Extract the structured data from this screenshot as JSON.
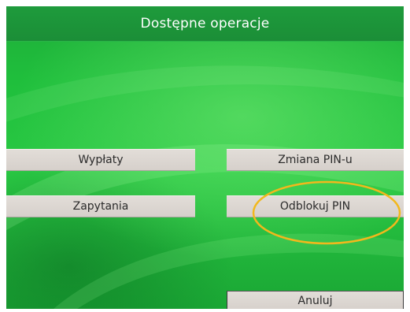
{
  "header": {
    "title": "Dostępne operacje"
  },
  "operations": {
    "withdraw_label": "Wypłaty",
    "inquiry_label": "Zapytania",
    "change_pin_label": "Zmiana PIN-u",
    "unblock_pin_label": "Odblokuj PIN",
    "cancel_label": "Anuluj"
  },
  "colors": {
    "screen_green": "#22bb3e",
    "title_bar_green": "#1e9b3c",
    "button_gray": "#dcd7d2",
    "highlight_ring": "#f2b81c"
  }
}
